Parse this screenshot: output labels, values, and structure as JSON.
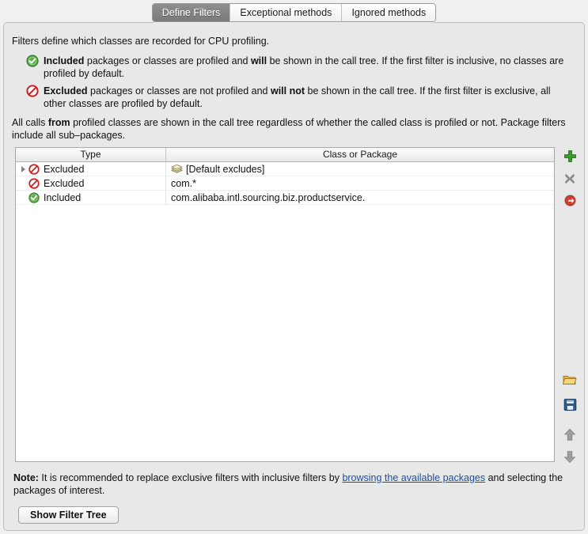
{
  "tabs": [
    {
      "label": "Define Filters",
      "active": true
    },
    {
      "label": "Exceptional methods",
      "active": false
    },
    {
      "label": "Ignored methods",
      "active": false
    }
  ],
  "description": {
    "intro": "Filters define which classes are recorded for CPU profiling.",
    "bullets": [
      {
        "icon": "included-check-icon",
        "segments": [
          {
            "text": "Included",
            "bold": true
          },
          {
            "text": " packages or classes are profiled and ",
            "bold": false
          },
          {
            "text": "will",
            "bold": true
          },
          {
            "text": " be shown in the call tree. If the first filter is inclusive, no classes are profiled by default.",
            "bold": false
          }
        ]
      },
      {
        "icon": "excluded-deny-icon",
        "segments": [
          {
            "text": "Excluded",
            "bold": true
          },
          {
            "text": " packages or classes are not profiled and ",
            "bold": false
          },
          {
            "text": "will not",
            "bold": true
          },
          {
            "text": " be shown in the call tree. If the first filter is exclusive, all other classes are profiled by default.",
            "bold": false
          }
        ]
      }
    ],
    "tail_segments": [
      {
        "text": "All calls ",
        "bold": false
      },
      {
        "text": "from",
        "bold": true
      },
      {
        "text": " profiled classes are shown in the call tree regardless of whether the called class is profiled or not. Package filters include all sub–packages.",
        "bold": false
      }
    ]
  },
  "table": {
    "columns": [
      "Type",
      "Class or Package"
    ],
    "rows": [
      {
        "expandable": true,
        "status": "excluded",
        "type": "Excluded",
        "package_icon": "package-stack-icon",
        "package": "[Default excludes]"
      },
      {
        "expandable": false,
        "status": "excluded",
        "type": "Excluded",
        "package_icon": null,
        "package": "com.*"
      },
      {
        "expandable": false,
        "status": "included",
        "type": "Included",
        "package_icon": null,
        "package": "com.alibaba.intl.sourcing.biz.productservice."
      }
    ]
  },
  "toolbar": {
    "top_buttons": [
      {
        "name": "add-filter-button",
        "icon": "plus-icon",
        "enabled": true
      },
      {
        "name": "remove-filter-button",
        "icon": "close-x-icon",
        "enabled": false
      },
      {
        "name": "toggle-filter-button",
        "icon": "red-arrow-circle-icon",
        "enabled": true
      }
    ],
    "bottom_buttons": [
      {
        "name": "open-filters-button",
        "icon": "folder-open-icon",
        "enabled": true
      },
      {
        "name": "save-filters-button",
        "icon": "floppy-save-icon",
        "enabled": true
      },
      {
        "name": "move-up-button",
        "icon": "arrow-up-icon",
        "enabled": false
      },
      {
        "name": "move-down-button",
        "icon": "arrow-down-icon",
        "enabled": false
      }
    ]
  },
  "note": {
    "label": "Note:",
    "text_before_link": " It is recommended to replace exclusive filters with inclusive filters by ",
    "link_text": "browsing the available packages",
    "text_after_link": " and selecting the packages of interest."
  },
  "footer": {
    "show_filter_tree_label": "Show Filter Tree"
  },
  "colors": {
    "included_green": "#4a9b3c",
    "excluded_red": "#cc2020",
    "link_blue": "#1b4f9c",
    "panel_bg": "#e8e8e8",
    "window_bg": "#f0f0f0"
  }
}
